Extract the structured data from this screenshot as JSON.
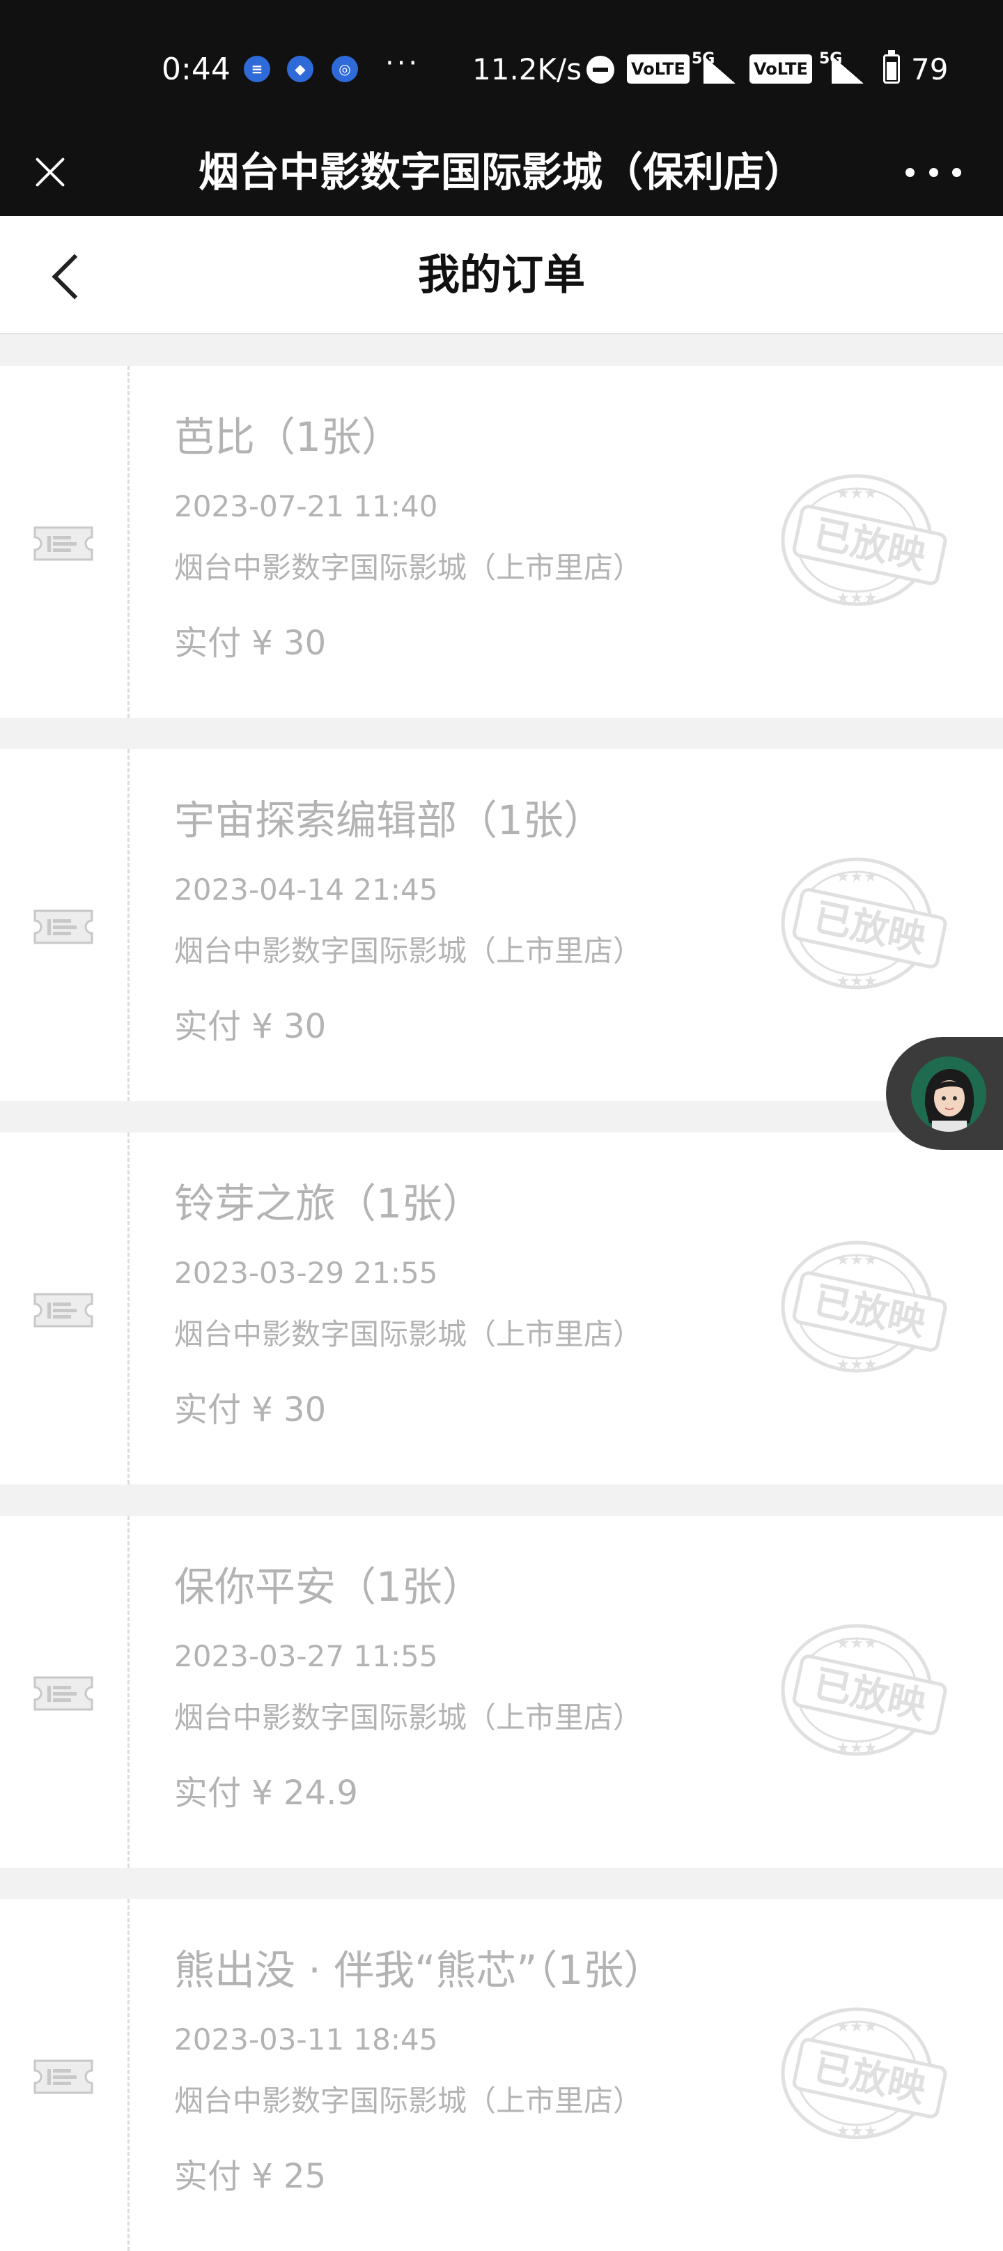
{
  "status_bar": {
    "time": "0:44",
    "network_speed": "11.2K/s",
    "volte_1": "VoLTE",
    "net_1": "5G",
    "volte_2": "VoLTE",
    "net_2": "5G",
    "battery": "79",
    "dots": "···"
  },
  "mini_program": {
    "title": "烟台中影数字国际影城（保利店）"
  },
  "header": {
    "title": "我的订单"
  },
  "orders": [
    {
      "title": "芭比（1张）",
      "datetime": "2023-07-21 11:40",
      "cinema": "烟台中影数字国际影城（上市里店）",
      "paid": "实付 ¥ 30",
      "stamp": "已放映"
    },
    {
      "title": "宇宙探索编辑部（1张）",
      "datetime": "2023-04-14 21:45",
      "cinema": "烟台中影数字国际影城（上市里店）",
      "paid": "实付 ¥ 30",
      "stamp": "已放映"
    },
    {
      "title": "铃芽之旅（1张）",
      "datetime": "2023-03-29 21:55",
      "cinema": "烟台中影数字国际影城（上市里店）",
      "paid": "实付 ¥ 30",
      "stamp": "已放映"
    },
    {
      "title": "保你平安（1张）",
      "datetime": "2023-03-27 11:55",
      "cinema": "烟台中影数字国际影城（上市里店）",
      "paid": "实付 ¥ 24.9",
      "stamp": "已放映"
    },
    {
      "title": "熊出没 · 伴我“熊芯”（1张）",
      "datetime": "2023-03-11 18:45",
      "cinema": "烟台中影数字国际影城（上市里店）",
      "paid": "实付 ¥ 25",
      "stamp": "已放映"
    }
  ],
  "colors": {
    "status_bar_bg": "#111111",
    "page_bg": "#f2f2f2",
    "card_bg": "#ffffff",
    "muted_text": "#b3b3b3"
  },
  "icons": {
    "close": "close-icon",
    "more": "more-dots-icon",
    "back": "back-chevron-icon",
    "ticket": "ticket-icon",
    "stamp": "screened-stamp-icon",
    "assistant": "assistant-avatar-icon"
  }
}
